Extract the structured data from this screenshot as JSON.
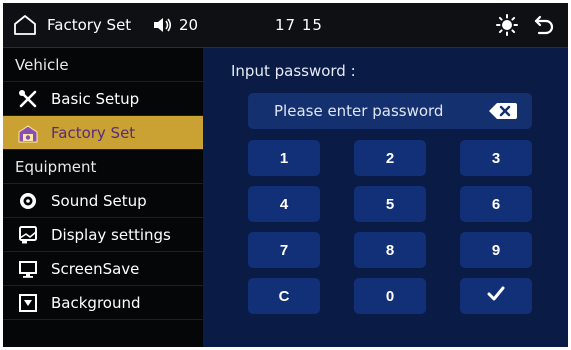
{
  "topbar": {
    "title": "Factory Set",
    "volume": "20",
    "clock": "17 15",
    "icons": [
      "home-icon",
      "volume-icon",
      "brightness-icon",
      "back-icon"
    ]
  },
  "sidebar": {
    "items": [
      {
        "type": "header",
        "label": "Vehicle"
      },
      {
        "type": "item",
        "label": "Basic Setup",
        "icon": "tools-icon"
      },
      {
        "type": "item",
        "label": "Factory Set",
        "icon": "factory-icon",
        "active": true
      },
      {
        "type": "header",
        "label": "Equipment"
      },
      {
        "type": "item",
        "label": "Sound Setup",
        "icon": "speaker-icon"
      },
      {
        "type": "item",
        "label": "Display settings",
        "icon": "display-icon"
      },
      {
        "type": "item",
        "label": "ScreenSave",
        "icon": "monitor-icon"
      },
      {
        "type": "item",
        "label": "Background",
        "icon": "background-icon"
      }
    ]
  },
  "password": {
    "label": "Input password :",
    "placeholder": "Please enter password",
    "clear_icon": "backspace-icon"
  },
  "keypad": {
    "keys": [
      "1",
      "2",
      "3",
      "4",
      "5",
      "6",
      "7",
      "8",
      "9",
      "C",
      "0"
    ],
    "confirm_icon": "checkmark-icon"
  },
  "colors": {
    "panel_bg": "#0a1b45",
    "key_bg": "#123078",
    "active_bg": "#c9a233",
    "active_text": "#5a2a7a",
    "sidebar_bg": "#050607"
  }
}
